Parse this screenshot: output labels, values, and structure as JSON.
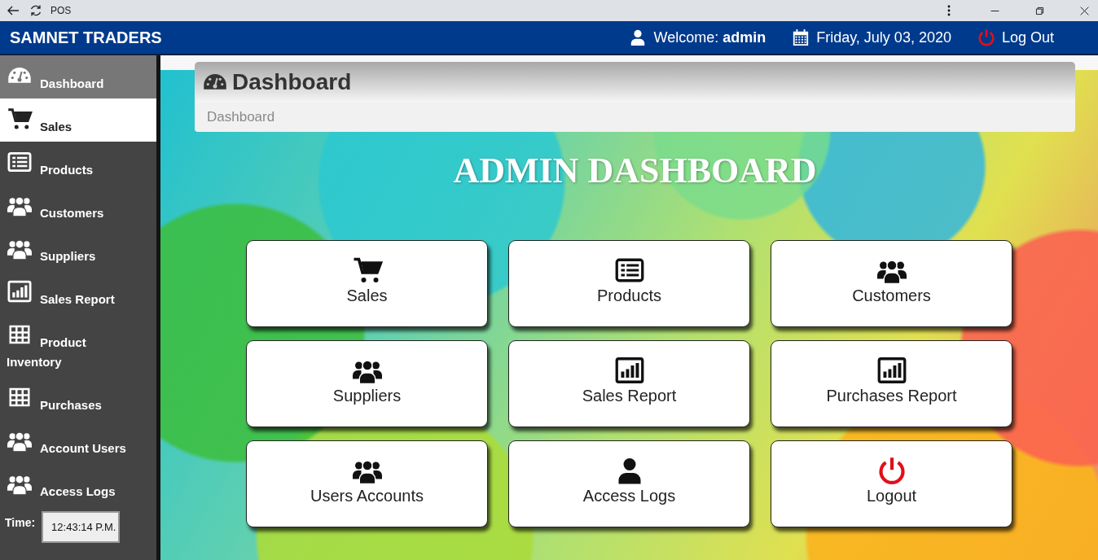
{
  "browser": {
    "title": "POS"
  },
  "header": {
    "brand": "SAMNET TRADERS",
    "welcome": "Welcome: **admin**",
    "date": "Friday, July 03, 2020",
    "logout": "Log Out"
  },
  "sidebar": {
    "items": [
      {
        "kind": "gauge",
        "label": "Dashboard",
        "selected": true,
        "hovered": false
      },
      {
        "kind": "cart",
        "label": "Sales",
        "selected": false,
        "hovered": true
      },
      {
        "kind": "list",
        "label": "Products",
        "selected": false,
        "hovered": false
      },
      {
        "kind": "users",
        "label": "Customers",
        "selected": false,
        "hovered": false
      },
      {
        "kind": "users",
        "label": "Suppliers",
        "selected": false,
        "hovered": false
      },
      {
        "kind": "chart",
        "label": "Sales Report",
        "selected": false,
        "hovered": false
      },
      {
        "kind": "grid",
        "label": "Product Inventory",
        "selected": false,
        "hovered": false
      },
      {
        "kind": "grid",
        "label": "Purchases",
        "selected": false,
        "hovered": false
      },
      {
        "kind": "users",
        "label": "Account Users",
        "selected": false,
        "hovered": false
      },
      {
        "kind": "users",
        "label": "Access Logs",
        "selected": false,
        "hovered": false
      }
    ],
    "time_label": "Time:",
    "time": "12:43:14 P.M."
  },
  "page": {
    "title": "Dashboard",
    "breadcrumb": "Dashboard",
    "heading": "ADMIN DASHBOARD"
  },
  "tiles": [
    {
      "kind": "cart",
      "label": "Sales"
    },
    {
      "kind": "list",
      "label": "Products"
    },
    {
      "kind": "users",
      "label": "Customers"
    },
    {
      "kind": "users",
      "label": "Suppliers"
    },
    {
      "kind": "chart",
      "label": "Sales Report"
    },
    {
      "kind": "chart",
      "label": "Purchases Report"
    },
    {
      "kind": "users",
      "label": "Users Accounts"
    },
    {
      "kind": "user",
      "label": "Access Logs"
    },
    {
      "kind": "power",
      "label": "Logout"
    }
  ]
}
